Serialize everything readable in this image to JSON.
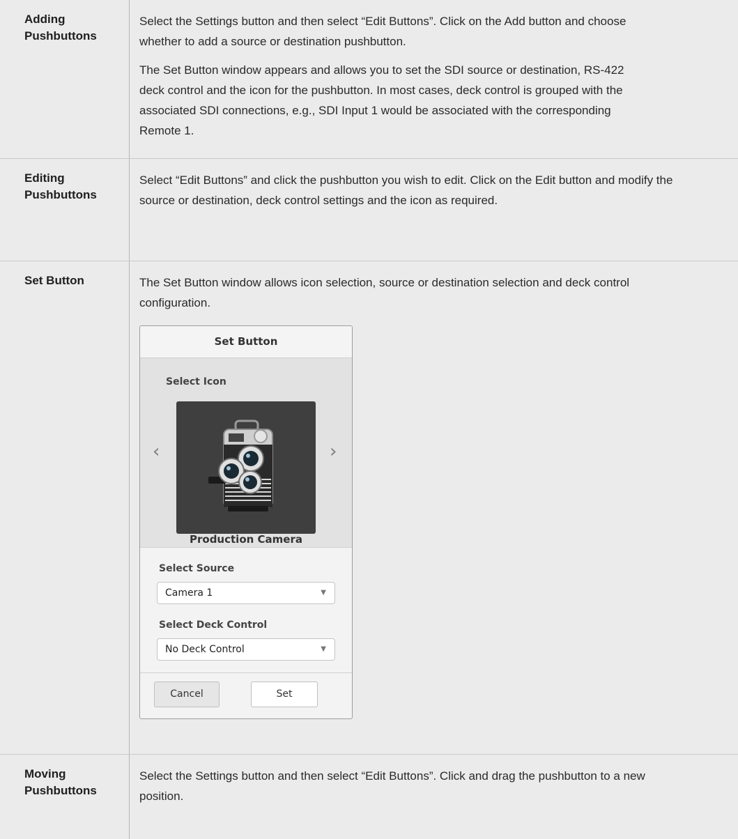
{
  "rows": [
    {
      "label": "Adding Pushbuttons",
      "paragraphs": [
        "Select the Settings button and then select “Edit Buttons”. Click on the Add button and choose whether to add a source or destination pushbutton.",
        "The Set Button window appears and allows you to set the SDI source or destination, RS-422 deck control and the icon for the pushbutton. In most cases, deck control is grouped with the associated SDI connections, e.g., SDI Input 1 would be associated with the corresponding Remote 1."
      ]
    },
    {
      "label": "Editing Pushbuttons",
      "paragraphs": [
        "Select “Edit Buttons” and click the pushbutton you wish to edit. Click on the Edit button and modify the source or destination, deck control settings and the icon as required."
      ]
    },
    {
      "label": "Set Button",
      "paragraphs": [
        "The Set Button window allows icon selection, source or destination selection and deck control configuration."
      ]
    },
    {
      "label": "Moving Pushbuttons",
      "paragraphs": [
        "Select the Settings button and then select “Edit Buttons”. Click and drag the pushbutton to a new position."
      ]
    }
  ],
  "dialog": {
    "title": "Set Button",
    "select_icon_label": "Select Icon",
    "icon_name": "Production Camera",
    "icon": "camera-icon",
    "prev_arrow": "‹",
    "next_arrow": "›",
    "select_source_label": "Select Source",
    "source_value": "Camera 1",
    "select_deck_label": "Select Deck Control",
    "deck_value": "No Deck Control",
    "caret": "▼",
    "cancel_label": "Cancel",
    "set_label": "Set"
  }
}
